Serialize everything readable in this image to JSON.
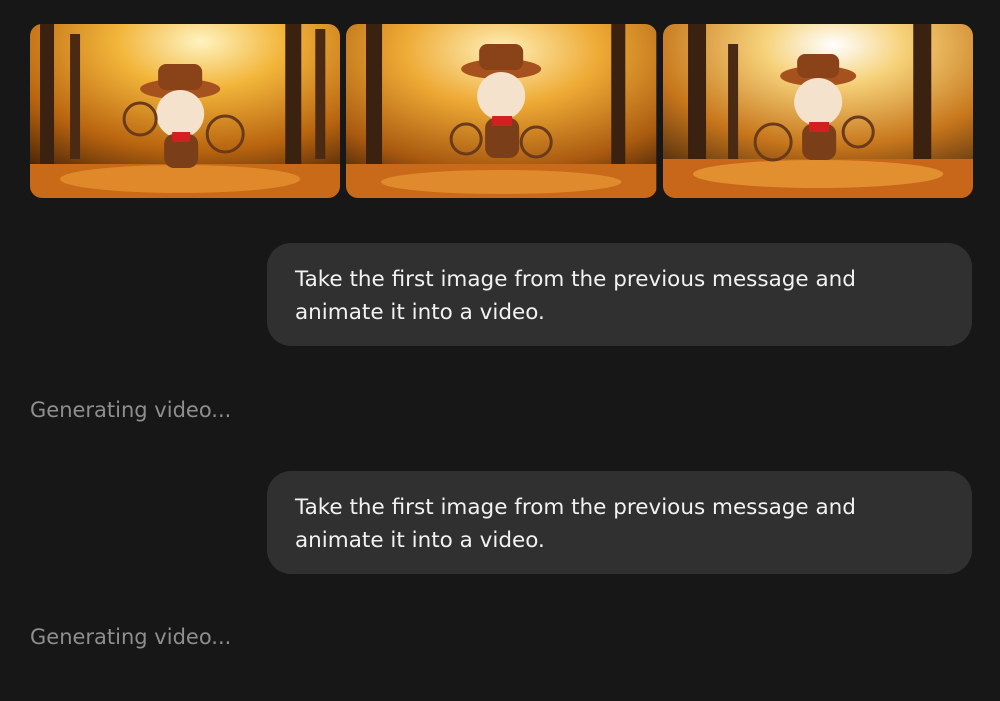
{
  "images": [
    {
      "alt_icon": "corgi-cowboy-autumn-image-1"
    },
    {
      "alt_icon": "corgi-cowboy-autumn-image-2"
    },
    {
      "alt_icon": "corgi-cowboy-autumn-image-3"
    }
  ],
  "messages": [
    {
      "role": "user",
      "text": "Take the first image from the previous message and animate it into a video."
    },
    {
      "role": "assistant",
      "text": "Generating video..."
    },
    {
      "role": "user",
      "text": "Take the first image from the previous message and animate it into a video."
    },
    {
      "role": "assistant",
      "text": "Generating video..."
    }
  ],
  "colors": {
    "background": "#171717",
    "bubble": "#303030",
    "status_text": "#8e8e8e"
  }
}
